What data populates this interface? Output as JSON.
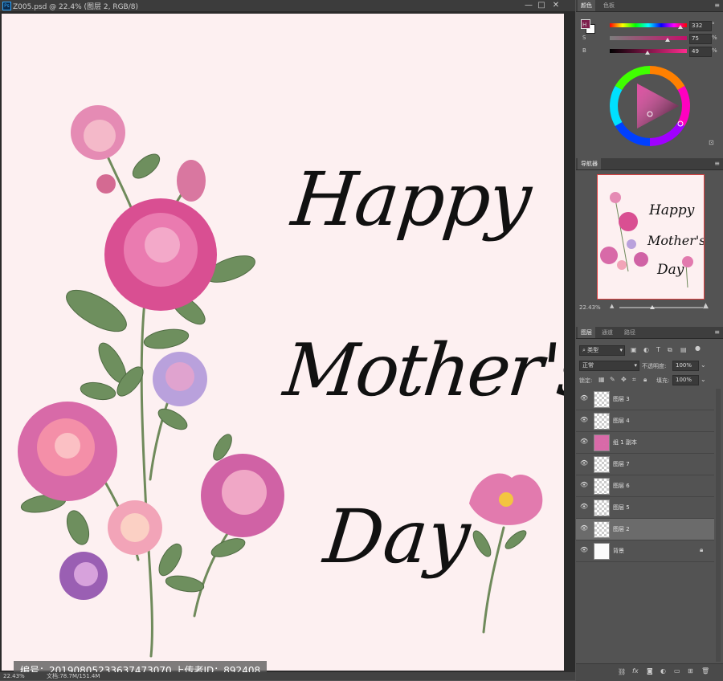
{
  "window": {
    "doc_title": "Z005.psd @ 22.4% (图层 2, RGB/8)",
    "app_icon": "Ps",
    "controls": [
      "—",
      "□",
      "✕"
    ]
  },
  "canvas": {
    "background": "#fdf0f1",
    "greeting": [
      "Happy",
      "Mother's",
      "Day"
    ],
    "watermark": "编号：20190805233637473070 上传者ID：892408"
  },
  "status_bar": {
    "zoom": "22.43%",
    "doc_size": "文档:78.7M/151.4M"
  },
  "color_panel": {
    "tabs": [
      "颜色",
      "色板"
    ],
    "rows": [
      {
        "label": "H",
        "value": "332",
        "unit": "°",
        "position": 0.92
      },
      {
        "label": "S",
        "value": "75",
        "unit": "%",
        "position": 0.75
      },
      {
        "label": "B",
        "value": "49",
        "unit": "%",
        "position": 0.49
      }
    ],
    "foreground": "#7d1f4c",
    "background": "#ffffff"
  },
  "navigator_panel": {
    "tab": "导航器",
    "zoom": "22.43%",
    "preview_text": [
      "Happy",
      "Mother's",
      "Day"
    ]
  },
  "layers_panel": {
    "tabs": [
      "图层",
      "通道",
      "路径"
    ],
    "filter_kind": "类型",
    "blend_mode": "正常",
    "opacity_label": "不透明度:",
    "opacity": "100%",
    "lock_label": "锁定:",
    "fill_label": "填充:",
    "fill": "100%",
    "layers": [
      {
        "name": "图层 3",
        "kind": "transparent",
        "selected": false,
        "locked": false
      },
      {
        "name": "图层 4",
        "kind": "transparent",
        "selected": false,
        "locked": false
      },
      {
        "name": "组 1 副本",
        "kind": "flower",
        "selected": false,
        "locked": false
      },
      {
        "name": "图层 7",
        "kind": "transparent",
        "selected": false,
        "locked": false
      },
      {
        "name": "图层 6",
        "kind": "transparent",
        "selected": false,
        "locked": false
      },
      {
        "name": "图层 5",
        "kind": "transparent",
        "selected": false,
        "locked": false
      },
      {
        "name": "图层 2",
        "kind": "transparent",
        "selected": true,
        "locked": false
      },
      {
        "name": "背景",
        "kind": "white",
        "selected": false,
        "locked": true
      }
    ],
    "footer_icons": [
      "link-icon",
      "fx-icon",
      "mask-icon",
      "adjustment-icon",
      "folder-icon",
      "new-layer-icon",
      "trash-icon"
    ]
  }
}
